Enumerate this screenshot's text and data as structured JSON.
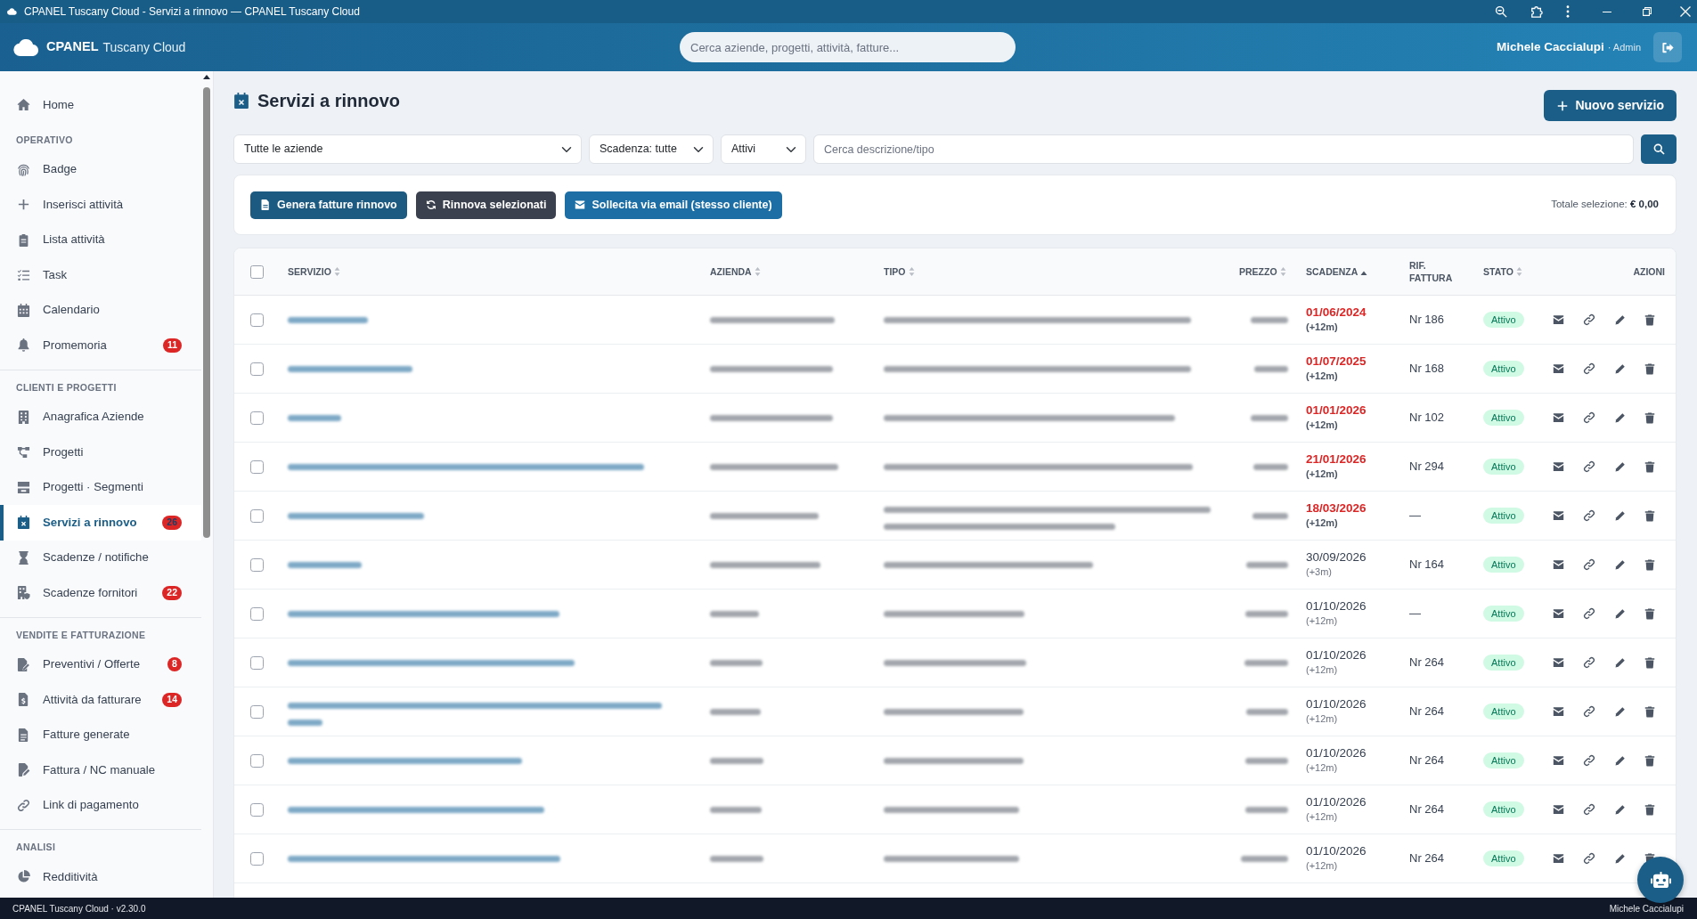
{
  "window": {
    "title": "CPANEL Tuscany Cloud - Servizi a rinnovo — CPANEL Tuscany Cloud"
  },
  "header": {
    "brand_name": "CPANEL",
    "brand_suffix": "Tuscany Cloud",
    "search": {
      "placeholder": "Cerca aziende, progetti, attività, fatture..."
    },
    "user": {
      "name": "Michele Caccialupi",
      "role": "· Admin"
    }
  },
  "sidebar": {
    "items": [
      {
        "kind": "link",
        "label": "Home",
        "selected": false
      },
      {
        "kind": "section",
        "label": "OPERATIVO"
      },
      {
        "kind": "link",
        "label": "Badge",
        "selected": false
      },
      {
        "kind": "link",
        "label": "Inserisci attività",
        "selected": false
      },
      {
        "kind": "link",
        "label": "Lista attività",
        "selected": false
      },
      {
        "kind": "link",
        "label": "Task",
        "selected": false
      },
      {
        "kind": "link",
        "label": "Calendario",
        "selected": false
      },
      {
        "kind": "link",
        "label": "Promemoria",
        "selected": false,
        "badge": "11"
      },
      {
        "kind": "section",
        "label": "CLIENTI E PROGETTI"
      },
      {
        "kind": "link",
        "label": "Anagrafica Aziende",
        "selected": false
      },
      {
        "kind": "link",
        "label": "Progetti",
        "selected": false
      },
      {
        "kind": "link",
        "label": "Progetti · Segmenti",
        "selected": false
      },
      {
        "kind": "link",
        "label": "Servizi a rinnovo",
        "selected": true,
        "badge": "26"
      },
      {
        "kind": "link",
        "label": "Scadenze / notifiche",
        "selected": false
      },
      {
        "kind": "link",
        "label": "Scadenze fornitori",
        "selected": false,
        "badge": "22"
      },
      {
        "kind": "section",
        "label": "VENDITE E FATTURAZIONE"
      },
      {
        "kind": "link",
        "label": "Preventivi / Offerte",
        "selected": false,
        "badge": "8"
      },
      {
        "kind": "link",
        "label": "Attività da fatturare",
        "selected": false,
        "badge": "14"
      },
      {
        "kind": "link",
        "label": "Fatture generate",
        "selected": false
      },
      {
        "kind": "link",
        "label": "Fattura / NC manuale",
        "selected": false
      },
      {
        "kind": "link",
        "label": "Link di pagamento",
        "selected": false
      },
      {
        "kind": "section",
        "label": "ANALISI"
      },
      {
        "kind": "link",
        "label": "Redditività",
        "selected": false
      }
    ]
  },
  "page": {
    "title": "Servizi a rinnovo",
    "new_button": "Nuovo servizio"
  },
  "filters": {
    "selects": [
      {
        "value": "Tutte le aziende"
      },
      {
        "value": "Scadenza: tutte"
      },
      {
        "value": "Attivi"
      }
    ],
    "search": {
      "placeholder": "Cerca descrizione/tipo"
    }
  },
  "actions": {
    "buttons": [
      {
        "label": "Genera fatture rinnovo",
        "kind": "invoice"
      },
      {
        "label": "Rinnova selezionati",
        "kind": "renew"
      },
      {
        "label": "Sollecita via email (stesso cliente)",
        "kind": "email"
      }
    ],
    "total": "Totale selezione: **€ 0,00**"
  },
  "table": {
    "select_all": false,
    "columns": [
      {
        "label": "SERVIZIO",
        "sortable": true,
        "sorted_ascending": false
      },
      {
        "label": "AZIENDA",
        "sortable": true,
        "sorted_ascending": false
      },
      {
        "label": "TIPO",
        "sortable": true,
        "sorted_ascending": false
      },
      {
        "label": "PREZZO",
        "sortable": true,
        "sorted_ascending": false
      },
      {
        "label": "SCADENZA",
        "sortable": true,
        "sorted_ascending": true
      },
      {
        "label": "RIF. FATTURA",
        "sortable": false,
        "sorted_ascending": false
      },
      {
        "label": "STATO",
        "sortable": true,
        "sorted_ascending": false
      },
      {
        "label": "AZIONI",
        "sortable": false,
        "sorted_ascending": false
      }
    ],
    "rows": [
      {
        "checked": false,
        "due": "01/06/2024",
        "overdue": true,
        "extension": "(+12m)",
        "invoice_ref": "Nr 186",
        "status": "Attivo"
      },
      {
        "checked": false,
        "due": "01/07/2025",
        "overdue": true,
        "extension": "(+12m)",
        "invoice_ref": "Nr 168",
        "status": "Attivo"
      },
      {
        "checked": false,
        "due": "01/01/2026",
        "overdue": true,
        "extension": "(+12m)",
        "invoice_ref": "Nr 102",
        "status": "Attivo"
      },
      {
        "checked": false,
        "due": "21/01/2026",
        "overdue": true,
        "extension": "(+12m)",
        "invoice_ref": "Nr 294",
        "status": "Attivo"
      },
      {
        "checked": false,
        "due": "18/03/2026",
        "overdue": true,
        "extension": "(+12m)",
        "invoice_ref": "—",
        "status": "Attivo"
      },
      {
        "checked": false,
        "due": "30/09/2026",
        "overdue": false,
        "extension": "(+3m)",
        "invoice_ref": "Nr 164",
        "status": "Attivo"
      },
      {
        "checked": false,
        "due": "01/10/2026",
        "overdue": false,
        "extension": "(+12m)",
        "invoice_ref": "—",
        "status": "Attivo"
      },
      {
        "checked": false,
        "due": "01/10/2026",
        "overdue": false,
        "extension": "(+12m)",
        "invoice_ref": "Nr 264",
        "status": "Attivo"
      },
      {
        "checked": false,
        "due": "01/10/2026",
        "overdue": false,
        "extension": "(+12m)",
        "invoice_ref": "Nr 264",
        "status": "Attivo"
      },
      {
        "checked": false,
        "due": "01/10/2026",
        "overdue": false,
        "extension": "(+12m)",
        "invoice_ref": "Nr 264",
        "status": "Attivo"
      },
      {
        "checked": false,
        "due": "01/10/2026",
        "overdue": false,
        "extension": "(+12m)",
        "invoice_ref": "Nr 264",
        "status": "Attivo"
      },
      {
        "checked": false,
        "due": "01/10/2026",
        "overdue": false,
        "extension": "(+12m)",
        "invoice_ref": "Nr 264",
        "status": "Attivo"
      }
    ]
  },
  "footer": {
    "version": "CPANEL Tuscany Cloud · v2.30.0",
    "user": "Michele Caccialupi"
  }
}
